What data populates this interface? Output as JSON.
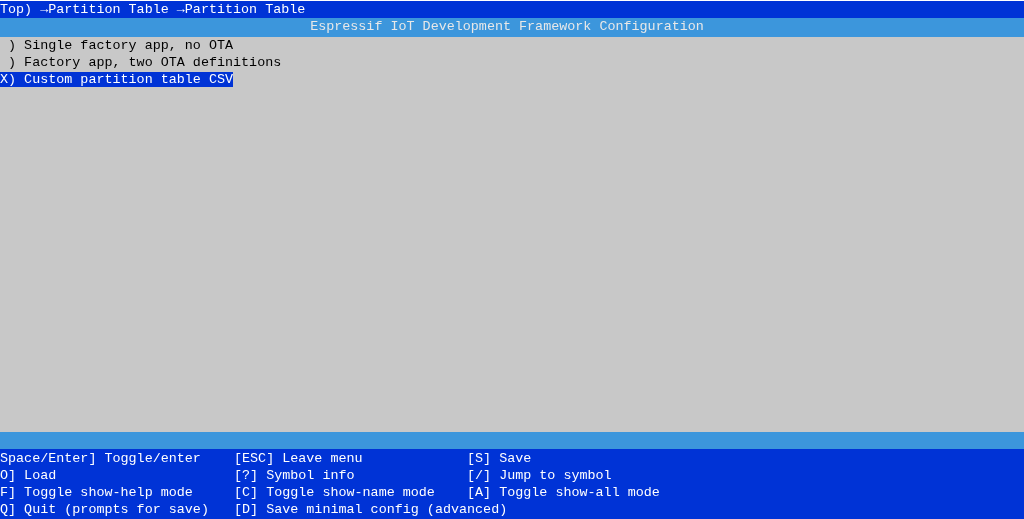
{
  "breadcrumb": "Top) →Partition Table →Partition Table",
  "title": "Espressif IoT Development Framework Configuration",
  "items": [
    {
      "text": " ) Single factory app, no OTA",
      "selected": false
    },
    {
      "text": " ) Factory app, two OTA definitions",
      "selected": false
    },
    {
      "text": "X) Custom partition table CSV",
      "selected": true
    }
  ],
  "help": [
    [
      "Space/Enter] Toggle/enter",
      "[ESC] Leave menu",
      "[S] Save"
    ],
    [
      "O] Load",
      "[?] Symbol info",
      "[/] Jump to symbol"
    ],
    [
      "F] Toggle show-help mode",
      "[C] Toggle show-name mode",
      "[A] Toggle show-all mode"
    ],
    [
      "Q] Quit (prompts for save)",
      "[D] Save minimal config (advanced)"
    ]
  ]
}
